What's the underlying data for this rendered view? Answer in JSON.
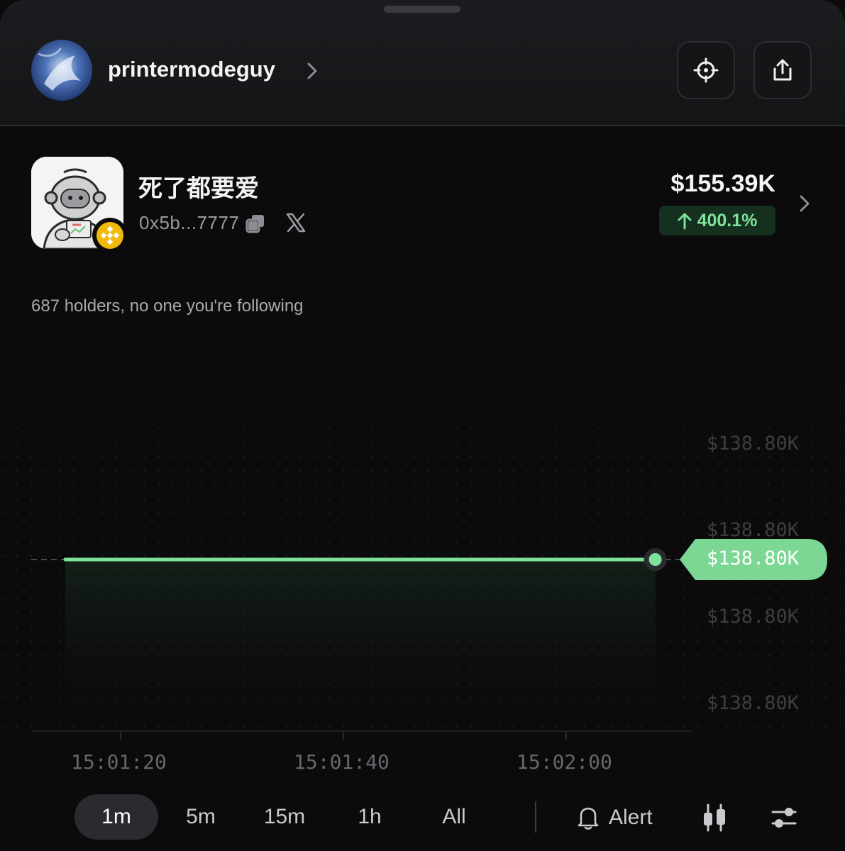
{
  "header": {
    "username": "printermodeguy"
  },
  "token": {
    "name": "死了都要爱",
    "address": "0x5b...7777",
    "market_cap": "$155.39K",
    "change": "400.1%"
  },
  "holders_text": "687 holders, no one you're following",
  "chart_data": {
    "type": "line",
    "x": [
      "15:01:00",
      "15:02:08"
    ],
    "y": [
      138800,
      138800
    ],
    "current_value_label": "$138.80K",
    "y_tick_labels": [
      "$138.80K",
      "$138.80K",
      "$138.80K",
      "$138.80K"
    ],
    "x_tick_labels": [
      "15:01:20",
      "15:01:40",
      "15:02:00"
    ],
    "line_color": "#7ee39a",
    "grid": "dotted"
  },
  "timeframes": [
    "1m",
    "5m",
    "15m",
    "1h",
    "All"
  ],
  "active_timeframe": "1m",
  "alert_label": "Alert",
  "colors": {
    "accent_green": "#7ee39a",
    "background": "#0b0b0c"
  },
  "icons": {
    "target": "crosshair-icon",
    "share": "share-icon",
    "copy": "copy-icon",
    "x": "x-logo-icon",
    "bell": "bell-icon",
    "candles": "candlestick-icon",
    "settings": "sliders-icon"
  }
}
